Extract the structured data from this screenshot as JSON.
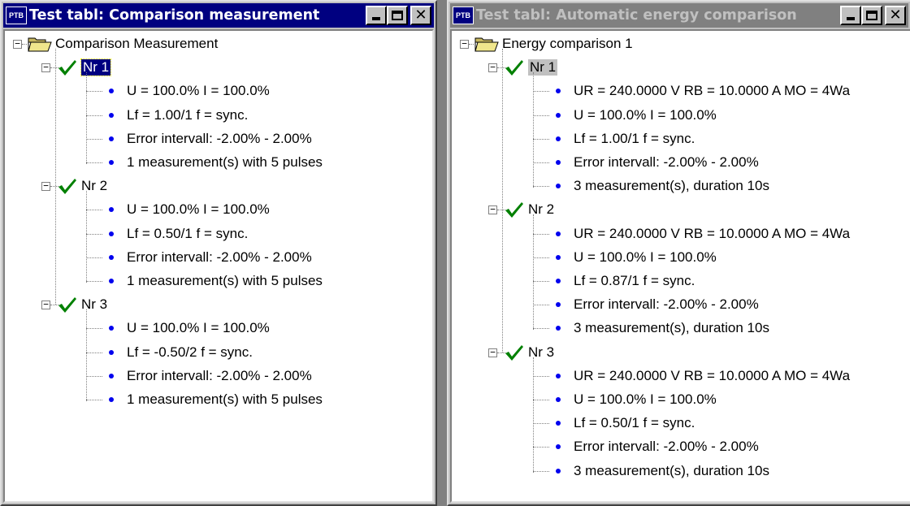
{
  "window1": {
    "title": "Test tabl: Comparison measurement",
    "icon": "PTB",
    "root": "Comparison Measurement",
    "groups": [
      {
        "label": "Nr 1",
        "items": [
          "U = 100.0%   I = 100.0%",
          "Lf =  1.00/1  f = sync.",
          "Error intervall:  -2.00% -   2.00%",
          "1 measurement(s) with  5 pulses"
        ]
      },
      {
        "label": "Nr 2",
        "items": [
          "U = 100.0%   I = 100.0%",
          "Lf =  0.50/1  f = sync.",
          "Error intervall:  -2.00% -   2.00%",
          "1 measurement(s) with  5 pulses"
        ]
      },
      {
        "label": "Nr 3",
        "items": [
          "U = 100.0%   I = 100.0%",
          "Lf = -0.50/2  f = sync.",
          "Error intervall:  -2.00% -   2.00%",
          "1 measurement(s) with  5 pulses"
        ]
      }
    ]
  },
  "window2": {
    "title": "Test tabl: Automatic energy comparison",
    "icon": "PTB",
    "root": "Energy comparison 1",
    "groups": [
      {
        "label": "Nr 1",
        "items": [
          "UR = 240.0000 V  RB =  10.0000 A  MO = 4Wa",
          "U = 100.0%   I = 100.0%",
          "Lf =  1.00/1  f = sync.",
          "Error intervall:  -2.00% -   2.00%",
          "3 measurement(s), duration 10s"
        ]
      },
      {
        "label": "Nr 2",
        "items": [
          "UR = 240.0000 V  RB =  10.0000 A  MO = 4Wa",
          "U = 100.0%   I = 100.0%",
          "Lf =  0.87/1  f = sync.",
          "Error intervall:  -2.00% -   2.00%",
          "3 measurement(s), duration 10s"
        ]
      },
      {
        "label": "Nr 3",
        "items": [
          "UR = 240.0000 V  RB =  10.0000 A  MO = 4Wa",
          "U = 100.0%   I = 100.0%",
          "Lf =  0.50/1  f = sync.",
          "Error intervall:  -2.00% -   2.00%",
          "3 measurement(s), duration 10s"
        ]
      }
    ]
  },
  "icons": {
    "app": "ptb-app-icon",
    "minimize": "minimize-icon",
    "maximize": "maximize-icon",
    "close": "close-icon",
    "folder": "open-folder-icon",
    "check": "green-checkmark-icon",
    "bullet": "blue-dot-icon",
    "expander": "tree-collapse-icon"
  },
  "colors": {
    "active_title": "#000080",
    "inactive_title": "#808080",
    "check": "#008000",
    "bullet": "#0000ee",
    "window_bg": "#c0c0c0"
  }
}
